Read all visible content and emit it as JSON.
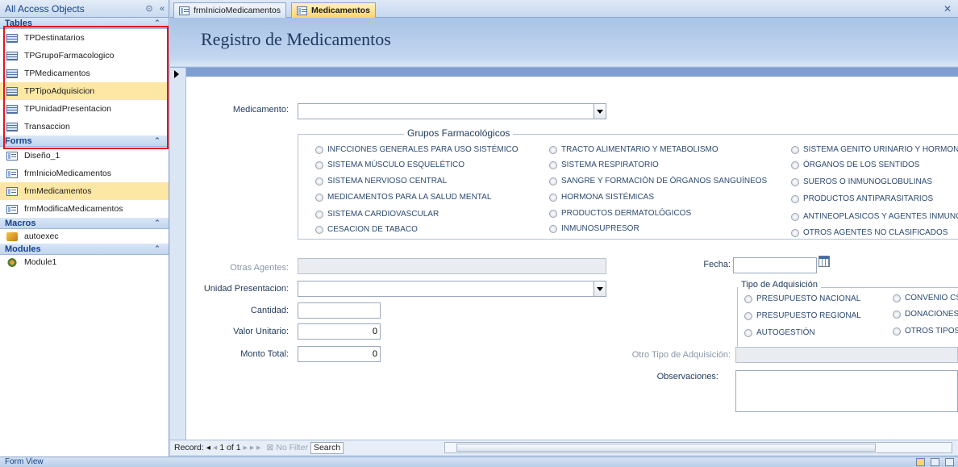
{
  "nav": {
    "title": "All Access Objects",
    "groups": {
      "tables": {
        "label": "Tables",
        "items": [
          "TPDestinatarios",
          "TPGrupoFarmacologico",
          "TPMedicamentos",
          "TPTipoAdquisicion",
          "TPUnidadPresentacion",
          "Transaccion"
        ]
      },
      "forms": {
        "label": "Forms",
        "items": [
          "Diseño_1",
          "frmInicioMedicamentos",
          "frmMedicamentos",
          "frmModificaMedicamentos"
        ]
      },
      "macros": {
        "label": "Macros",
        "items": [
          "autoexec"
        ]
      },
      "modules": {
        "label": "Modules",
        "items": [
          "Module1"
        ]
      }
    }
  },
  "tabs": [
    "frmInicioMedicamentos",
    "Medicamentos"
  ],
  "form": {
    "title": "Registro de Medicamentos",
    "medicamento_label": "Medicamento:",
    "grupos_title": "Grupos Farmacológicos",
    "grupos": [
      "INFCCIONES GENERALES PARA USO SISTÉMICO",
      "SISTEMA MÚSCULO ESQUELÉTICO",
      "SISTEMA NERVIOSO CENTRAL",
      "MEDICAMENTOS PARA LA SALUD MENTAL",
      "SISTEMA CARDIOVASCULAR",
      "CESACION DE TABACO",
      "TRACTO ALIMENTARIO Y METABOLISMO",
      "SISTEMA RESPIRATORIO",
      "SANGRE Y FORMACIÓN DE ÓRGANOS SANGUÍNEOS",
      "HORMONA SISTÉMICAS",
      "PRODUCTOS DERMATOLÓGICOS",
      "INMUNOSUPRESOR",
      "SISTEMA GENITO URINARIO Y HORMONA",
      "ÓRGANOS DE LOS SENTIDOS",
      "SUEROS O INMUNOGLOBULINAS",
      "PRODUCTOS ANTIPARASITARIOS",
      "ANTINEOPLASICOS Y AGENTES INMUNOL",
      "OTROS AGENTES NO CLASIFICADOS"
    ],
    "otras_agentes_label": "Otras Agentes:",
    "fecha_label": "Fecha:",
    "unidad_label": "Unidad Presentacion:",
    "tipo_title": "Tipo de Adquisición",
    "tipos": [
      "PRESUPUESTO NACIONAL",
      "PRESUPUESTO REGIONAL",
      "AUTOGESTIÓN",
      "CONVENIO CS",
      "DONACIONES",
      "OTROS TIPOS"
    ],
    "cantidad_label": "Cantidad:",
    "valor_label": "Valor Unitario:",
    "valor_value": "0",
    "monto_label": "Monto Total:",
    "monto_value": "0",
    "otro_tipo_label": "Otro Tipo de Adquisición:",
    "observaciones_label": "Observaciones:"
  },
  "recnav": {
    "record_label": "Record:",
    "position": "1 of 1",
    "no_filter": "No Filter",
    "search": "Search"
  },
  "status": "Form View"
}
